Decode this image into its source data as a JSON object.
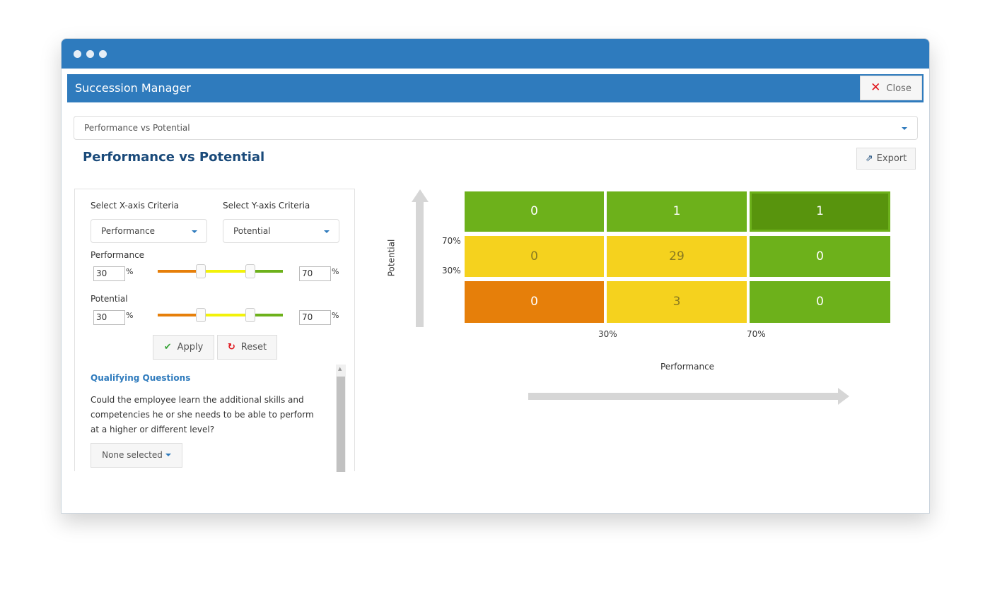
{
  "window": {
    "title": "Succession Manager",
    "close_label": "Close"
  },
  "report_select": {
    "value": "Performance vs Potential"
  },
  "page_title": "Performance vs Potential",
  "export_label": "Export",
  "filters": {
    "x_axis_label": "Select X-axis Criteria",
    "x_axis_value": "Performance",
    "y_axis_label": "Select Y-axis Criteria",
    "y_axis_value": "Potential",
    "performance": {
      "label": "Performance",
      "low": "30",
      "high": "70",
      "unit": "%"
    },
    "potential": {
      "label": "Potential",
      "low": "30",
      "high": "70",
      "unit": "%"
    },
    "apply_label": "Apply",
    "reset_label": "Reset"
  },
  "qualifying": {
    "title": "Qualifying Questions",
    "question": "Could the employee learn the additional skills and competencies he or she needs to be able to perform at a higher or different level?",
    "dropdown": "None selected"
  },
  "grid": {
    "x_label": "Performance",
    "y_label": "Potential",
    "x_ticks": [
      "30%",
      "70%"
    ],
    "y_ticks": [
      "70%",
      "30%"
    ],
    "rows": [
      [
        "0",
        "1",
        "1"
      ],
      [
        "0",
        "29",
        "0"
      ],
      [
        "0",
        "3",
        "0"
      ]
    ],
    "colors": {
      "green": "#6db11b",
      "dark_green": "#58940d",
      "yellow": "#f5d21e",
      "orange": "#e67f0a"
    }
  }
}
